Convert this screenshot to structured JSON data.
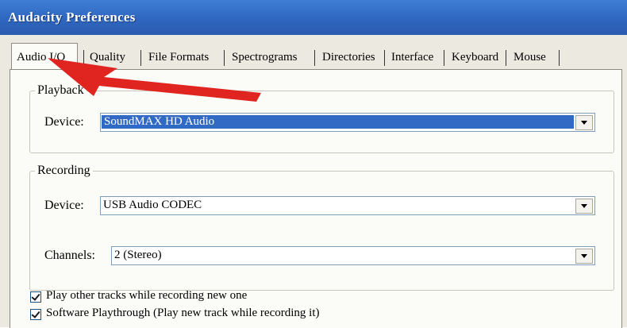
{
  "window": {
    "title": "Audacity Preferences"
  },
  "tabs": [
    "Audio I/O",
    "Quality",
    "File Formats",
    "Spectrograms",
    "Directories",
    "Interface",
    "Keyboard",
    "Mouse"
  ],
  "playback": {
    "legend": "Playback",
    "device_label": "Device:",
    "device_value": "SoundMAX HD Audio"
  },
  "recording": {
    "legend": "Recording",
    "device_label": "Device:",
    "device_value": "USB Audio CODEC",
    "channels_label": "Channels:",
    "channels_value": "2 (Stereo)"
  },
  "options": [
    {
      "label": "Play other tracks while recording new one",
      "checked": true
    },
    {
      "label": "Software Playthrough (Play new track while recording it)",
      "checked": true
    }
  ],
  "annotation": {
    "color": "#e0241f"
  }
}
